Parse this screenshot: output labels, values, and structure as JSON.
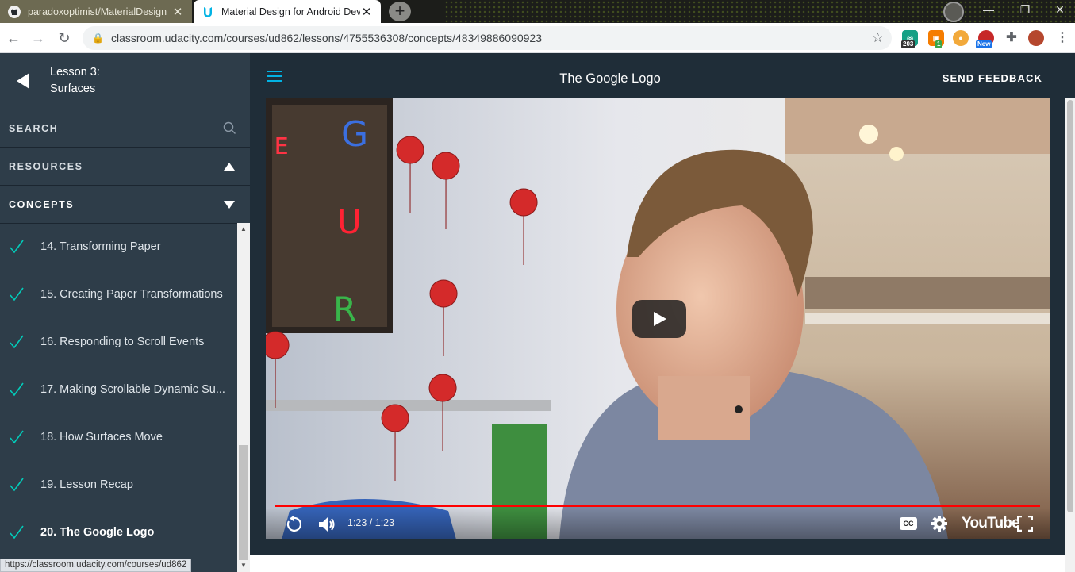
{
  "browser": {
    "tabs": [
      {
        "title": "paradoxoptimist/MaterialDesign",
        "close": "✕"
      },
      {
        "title": "Material Design for Android Deve",
        "close": "✕"
      }
    ],
    "new_tab": "+",
    "window_controls": {
      "minimize": "—",
      "maximize": "❐",
      "close": "✕"
    },
    "url": "classroom.udacity.com/courses/ud862/lessons/4755536308/concepts/48349886090923",
    "extensions": [
      {
        "name": "extension-203",
        "badge": "203",
        "color": "#15a085"
      },
      {
        "name": "extension-orange",
        "badge": "1",
        "color": "#f57c00"
      },
      {
        "name": "extension-cookie",
        "color": "#f2a93b"
      },
      {
        "name": "extension-new",
        "badge": "New",
        "color": "#1a73e8"
      },
      {
        "name": "extensions-puzzle",
        "color": "#5f6368"
      },
      {
        "name": "profile-avatar",
        "color": "#b5472e"
      }
    ],
    "status_url": "https://classroom.udacity.com/courses/ud862"
  },
  "sidebar": {
    "lesson_line1": "Lesson 3:",
    "lesson_line2": "Surfaces",
    "search_label": "SEARCH",
    "resources_label": "RESOURCES",
    "concepts_label": "CONCEPTS",
    "concepts": [
      {
        "label": "14. Transforming Paper",
        "done": true
      },
      {
        "label": "15. Creating Paper Transformations",
        "done": true
      },
      {
        "label": "16. Responding to Scroll Events",
        "done": true
      },
      {
        "label": "17. Making Scrollable Dynamic Su...",
        "done": true
      },
      {
        "label": "18. How Surfaces Move",
        "done": true
      },
      {
        "label": "19. Lesson Recap",
        "done": true
      },
      {
        "label": "20. The Google Logo",
        "done": true,
        "current": true
      }
    ]
  },
  "header": {
    "title": "The Google Logo",
    "feedback": "SEND FEEDBACK"
  },
  "video": {
    "time": "1:23 / 1:23",
    "progress": 1.0,
    "brand": "YouTube",
    "cc": "CC"
  },
  "colors": {
    "sidebar_bg": "#2e3d49",
    "header_bg": "#1f2d38",
    "accent_blue": "#02b3e4",
    "check_teal": "#02ccba",
    "progress_red": "#ff0000"
  }
}
